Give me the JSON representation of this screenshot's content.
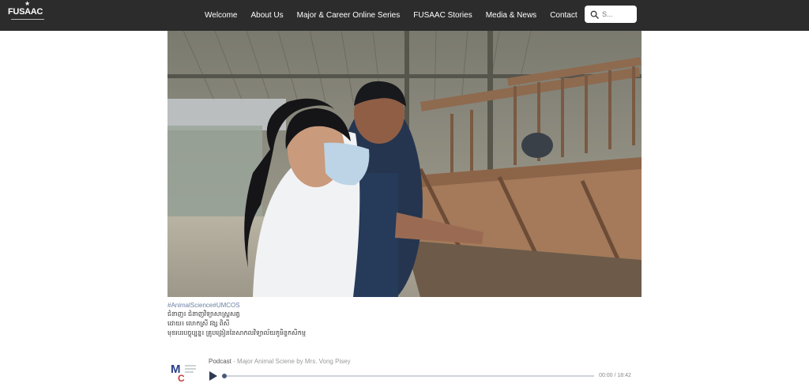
{
  "nav": {
    "logo_text": "FUSAAC",
    "items": [
      "Welcome",
      "About Us",
      "Major & Career Online Series",
      "FUSAAC Stories",
      "Media & News",
      "Contact"
    ],
    "search_placeholder": "S..."
  },
  "post": {
    "hashtag": "#AnimalScience#UMCOS",
    "lines": [
      "ជំនាញ៖ ជំនាញវិទ្យាសាស្ត្រសត្វ",
      "ដោយ៖ លោកស្រី វង្ស ពិសី",
      "មុខរបរបច្ចុប្បន្ន៖ គ្រូបង្រៀននៃសាកលវិទ្យាល័យភូមិន្ទកសិកម្ម"
    ]
  },
  "podcast": {
    "label": "Podcast",
    "separator": "-",
    "episode": "Major Animal Sciene by Mrs. Vong Pisey",
    "time": "00:00 / 18:42",
    "progress": 0.0
  },
  "colors": {
    "nav_bg": "#2c2c2c",
    "accent": "#4a5a78",
    "hashtag": "#6b7fa3"
  },
  "icons": [
    "search-icon",
    "play-icon",
    "podcast-logo"
  ]
}
